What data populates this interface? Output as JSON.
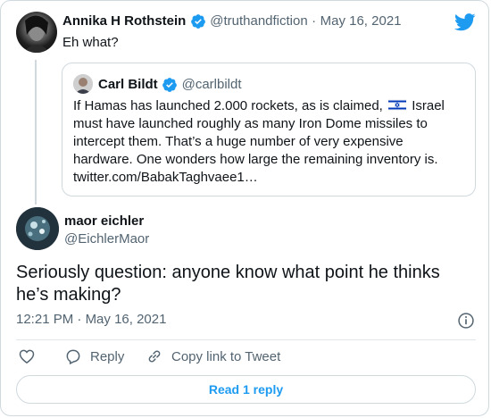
{
  "reply_tweet": {
    "author_name": "Annika H Rothstein",
    "author_handle": "@truthandfiction",
    "separator": "·",
    "date": "May 16, 2021",
    "text": "Eh what?"
  },
  "quoted_tweet": {
    "author_name": "Carl Bildt",
    "author_handle": "@carlbildt",
    "text_before_flag": "If Hamas has launched 2.000 rockets, as is claimed,",
    "text_after_flag": "Israel must have launched roughly as many Iron Dome missiles to intercept them. That’s a huge number of very expensive hardware. One wonders how large the remaining inventory is. twitter.com/BabakTaghvaee1…"
  },
  "main_tweet": {
    "author_name": "maor eichler",
    "author_handle": "@EichlerMaor",
    "text": "Seriously question: anyone know what point he thinks he’s making?",
    "time": "12:21 PM",
    "separator": "·",
    "date": "May 16, 2021"
  },
  "actions": {
    "reply_label": "Reply",
    "copy_link_label": "Copy link to Tweet"
  },
  "read_replies_label": "Read 1 reply",
  "colors": {
    "brand_blue": "#1d9bf0",
    "text": "#0f1419",
    "muted": "#536471",
    "border": "#cfd9de"
  },
  "icons": [
    "twitter-bird-icon",
    "verified-badge-icon",
    "info-icon",
    "heart-icon",
    "reply-icon",
    "link-icon",
    "israel-flag-icon"
  ]
}
